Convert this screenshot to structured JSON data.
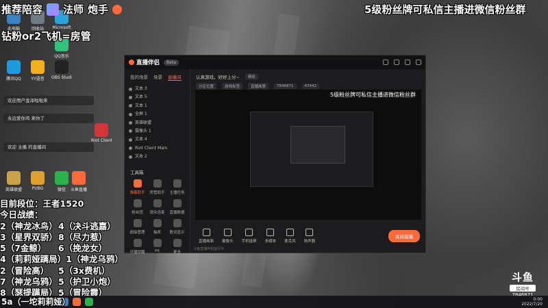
{
  "overlay": {
    "top_left": "推荐陪容",
    "top_left_2": "法师",
    "top_left_3": "炮手",
    "top_right": "5级粉丝牌可私信主播进微信粉丝群",
    "subtitle": "钻粉or2飞机=房管",
    "rank_title": "目前段位：王者1520",
    "today_title": "今日战绩：",
    "records": [
      [
        "2（神龙冰鸟）",
        "4（决斗逃嘉）"
      ],
      [
        "3（星界双骄）",
        "8（尽力惹）"
      ],
      [
        "5（7金鲸）",
        "6（挽龙女）"
      ],
      [
        "4（莉莉娅蹒局）",
        "1（神龙乌鸦）"
      ],
      [
        "2（冒险高）",
        "5（3x费机）"
      ],
      [
        "7（神龙乌鸦）",
        "5（护卫小炮）"
      ],
      [
        "8（瑟提蹒局）",
        "5（冒险霞）"
      ]
    ],
    "bottom_tag": "5a（一坨莉莉娅）"
  },
  "notices": [
    "欢迎用户金泽啦啦来",
    "永远爱你鸡 来你了",
    "欢迎 主播 的直播间"
  ],
  "desktop_icons": [
    {
      "label": "此电脑",
      "color": "#3b82c4"
    },
    {
      "label": "回收站",
      "color": "#6f7a86"
    },
    {
      "label": "Microsoft",
      "color": "#2aa4d8"
    },
    {
      "label": "腾讯QQ",
      "color": "#1e9be0"
    },
    {
      "label": "YY语音",
      "color": "#f2b01e"
    },
    {
      "label": "OBS Studio",
      "color": "#222222"
    },
    {
      "label": "英雄联盟",
      "color": "#c9a24a"
    },
    {
      "label": "PUBG",
      "color": "#e0a030"
    },
    {
      "label": "微信",
      "color": "#2bb24c"
    },
    {
      "label": "斗鱼直播",
      "color": "#ff6a3d"
    },
    {
      "label": "QQ音乐",
      "color": "#31c27c"
    },
    {
      "label": "Riot Client",
      "color": "#d13639"
    }
  ],
  "app": {
    "title": "直播伴侣",
    "badge": "Beta",
    "tabs": [
      "我的场景",
      "场景",
      "直播间"
    ],
    "active_tab": "直播间",
    "layers": [
      "文本 3",
      "文本 5",
      "文本 1",
      "全屏 1",
      "英雄联盟",
      "摄像头 1",
      "文本 4",
      "Riot Client Main",
      "文本 2"
    ],
    "tools_title": "工具箱",
    "tools": [
      "弹幕助手",
      "房管助手",
      "主播任务",
      "粉丝团",
      "观众连麦",
      "直播数据",
      "超级管理",
      "抽奖",
      "歌词显示",
      "开播提醒",
      "PK",
      "更多"
    ],
    "header_line": "认真游戏，好好上分~",
    "header_tag": "精彩",
    "chips": [
      "分区位置",
      "游戏标签",
      "直播画质",
      "7846871",
      "47442"
    ],
    "preview_caption": "5级粉丝牌可私信主播进微信粉丝群",
    "bottom_actions": [
      "直播画面",
      "摄像头",
      "手机投屏",
      "多媒体",
      "麦克风",
      "扬声器"
    ],
    "live_button": "关闭直播",
    "status": "斗鱼直播伴侣运行中"
  },
  "brand": {
    "logo": "斗鱼",
    "room_label": "房间号",
    "room": "7846871",
    "accent": "#ff6a3d"
  },
  "tray": {
    "time": "0:00",
    "date": "2022/7/20"
  }
}
